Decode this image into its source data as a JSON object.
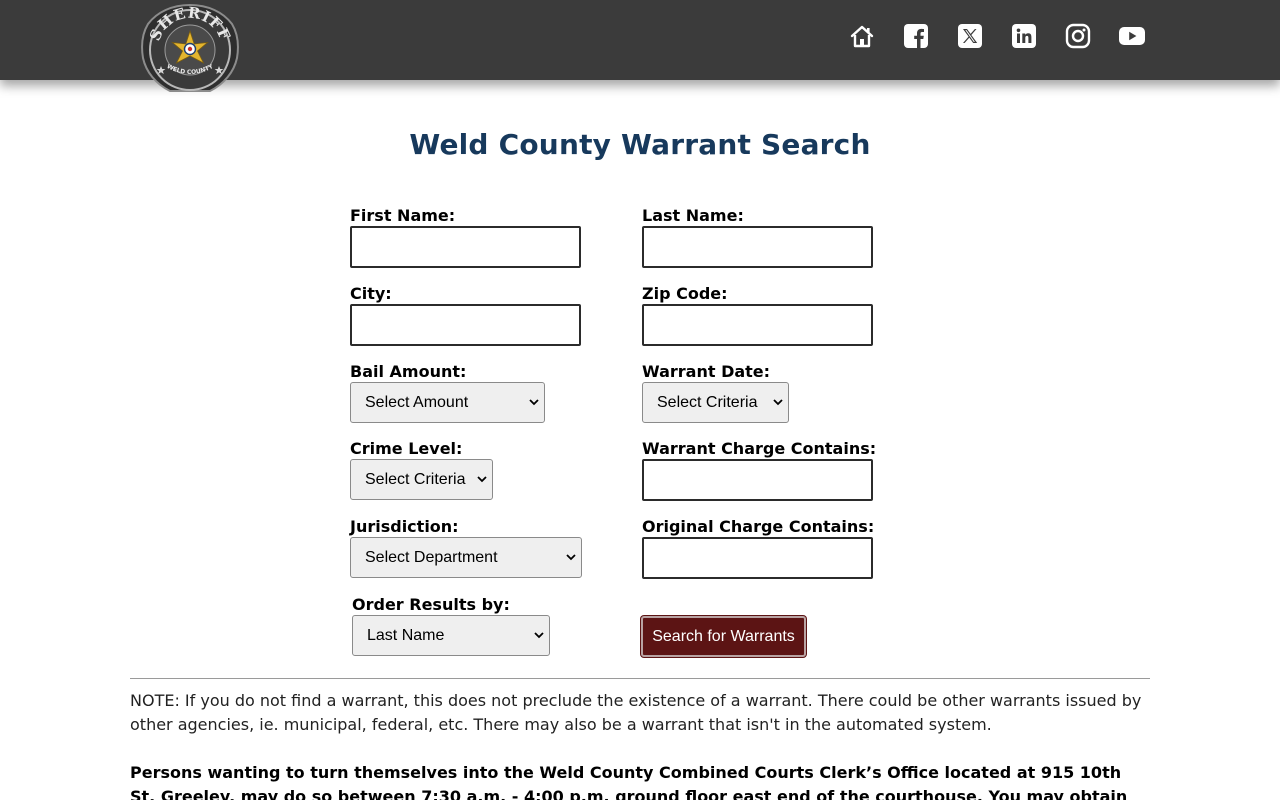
{
  "header": {
    "logo": {
      "top_text": "SHERIFF",
      "bottom_text": "WELD COUNTY"
    },
    "social_icons": [
      "home-icon",
      "facebook-icon",
      "x-twitter-icon",
      "linkedin-icon",
      "instagram-icon",
      "youtube-icon"
    ]
  },
  "page": {
    "title": "Weld County Warrant Search"
  },
  "form": {
    "first_name": {
      "label": "First Name:",
      "value": ""
    },
    "last_name": {
      "label": "Last Name:",
      "value": ""
    },
    "city": {
      "label": "City:",
      "value": ""
    },
    "zip_code": {
      "label": "Zip Code:",
      "value": ""
    },
    "bail_amount": {
      "label": "Bail Amount:",
      "selected": "Select Amount"
    },
    "warrant_date": {
      "label": "Warrant Date:",
      "selected": "Select Criteria"
    },
    "crime_level": {
      "label": "Crime Level:",
      "selected": "Select Criteria"
    },
    "warrant_charge": {
      "label": "Warrant Charge Contains:",
      "value": ""
    },
    "jurisdiction": {
      "label": "Jurisdiction:",
      "selected": "Select Department"
    },
    "original_charge": {
      "label": "Original Charge Contains:",
      "value": ""
    },
    "order_by": {
      "label": "Order Results by:",
      "selected": "Last Name"
    },
    "search_button": "Search for Warrants"
  },
  "notes": {
    "note": "NOTE: If you do not find a warrant, this does not preclude the existence of a warrant. There could be other warrants issued by other agencies, ie. municipal, federal, etc. There may also be a warrant that isn't in the automated system.",
    "persons": "Persons wanting to turn themselves into the Weld County Combined Courts Clerk’s Office located at 915 10th St, Greeley, may do so between 7:30 a.m. - 4:00 p.m. ground floor east end of the courthouse. You may obtain information from the courthouse"
  },
  "colors": {
    "header_bg": "#3b3b3b",
    "title": "#17395c",
    "button_bg": "#5c1414"
  }
}
